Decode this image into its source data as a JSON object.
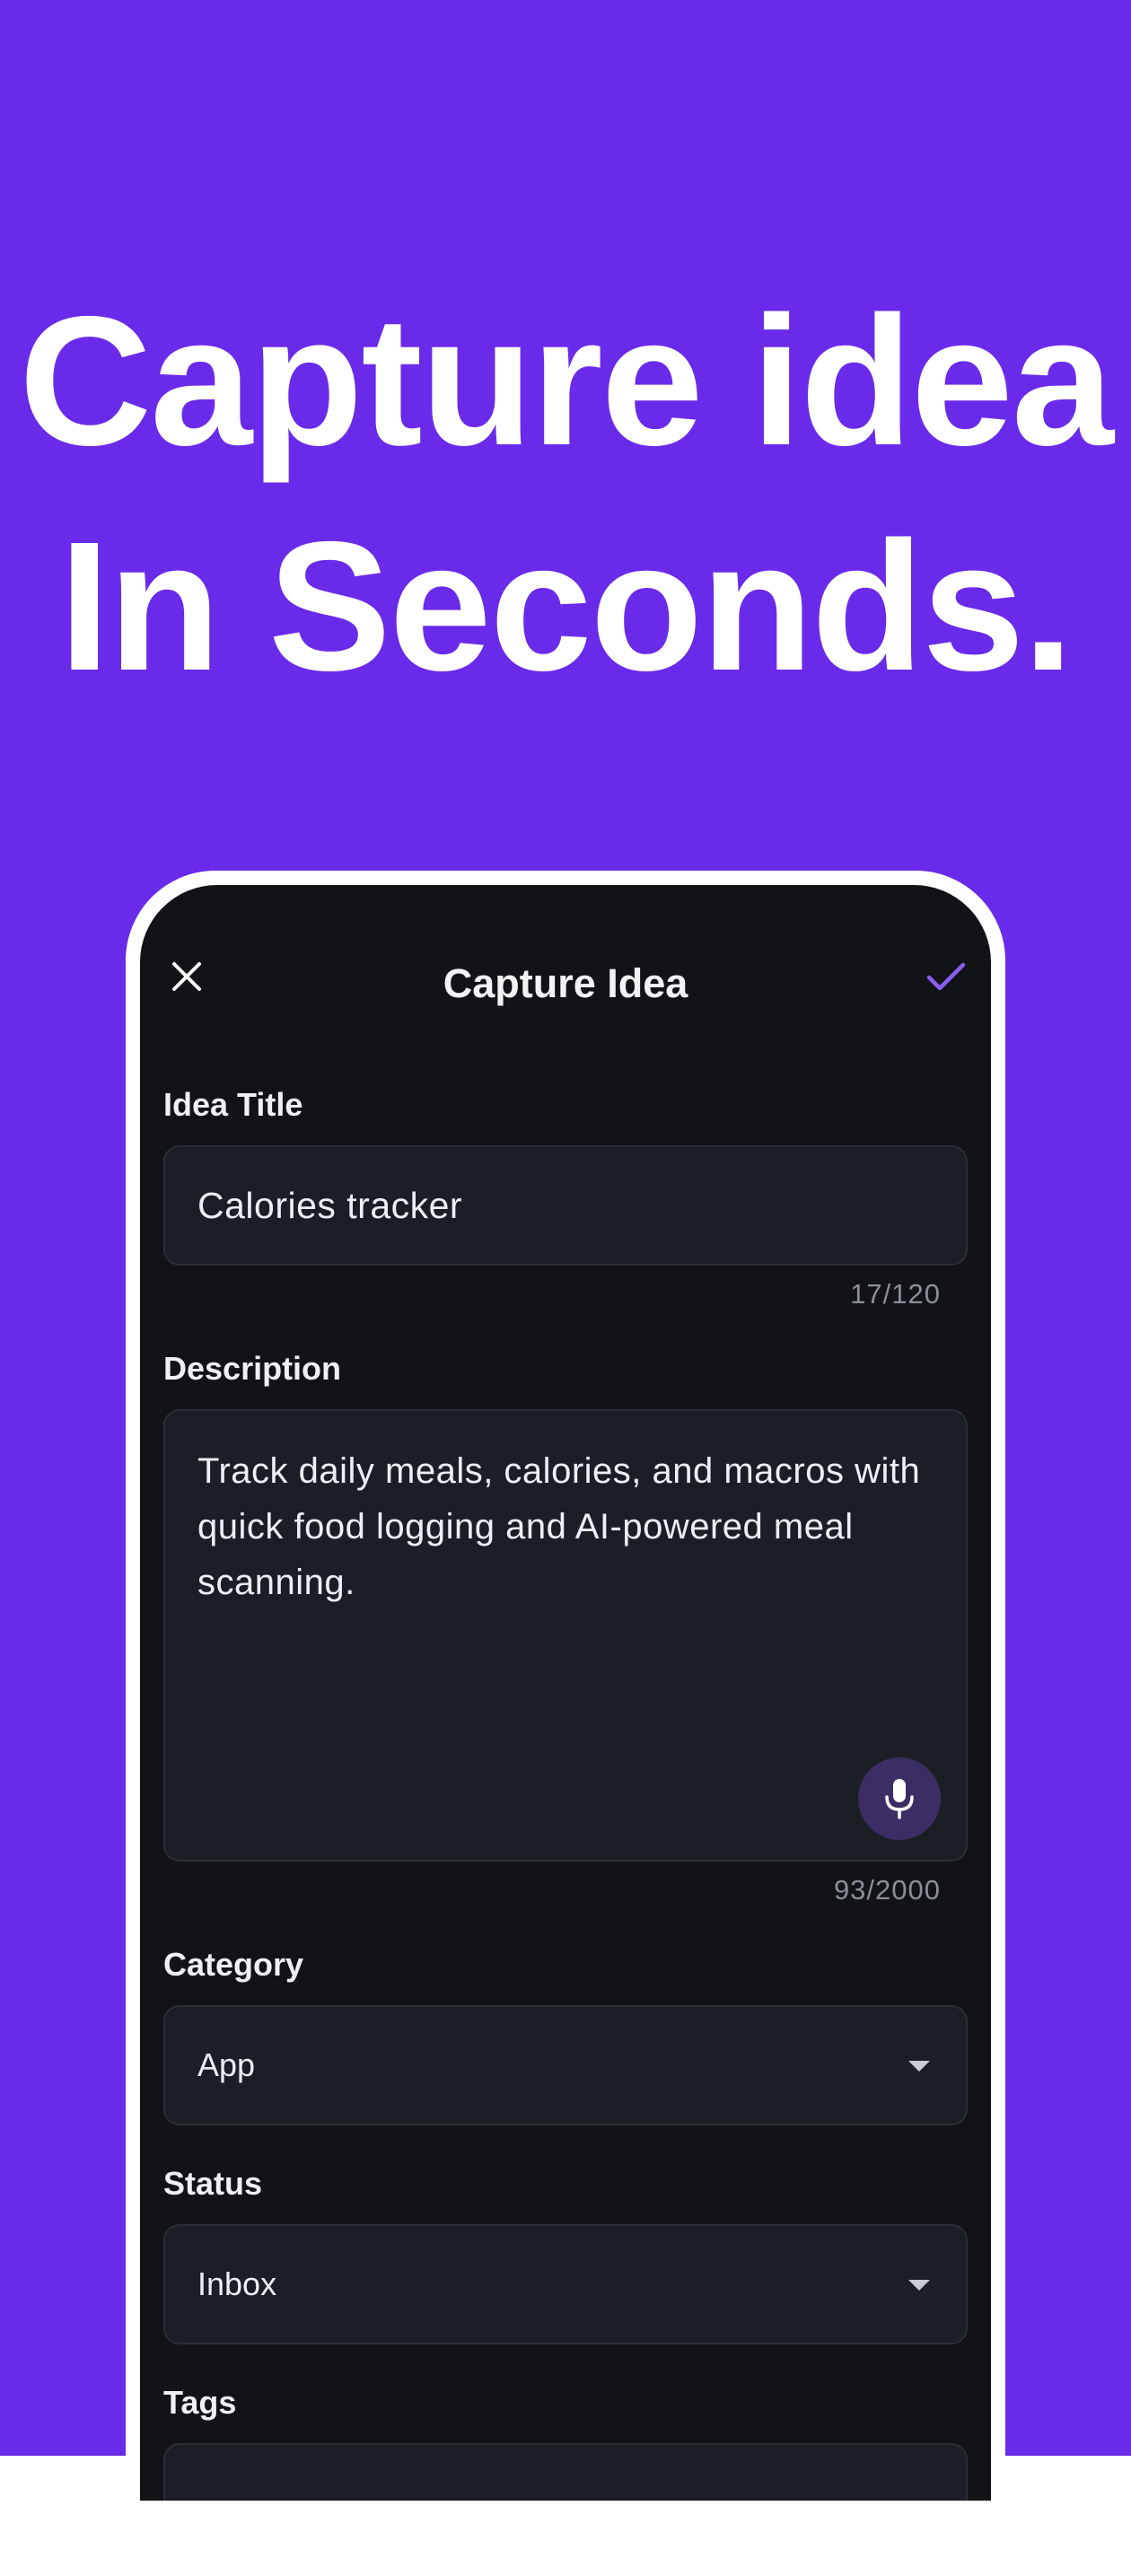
{
  "hero": {
    "line1": "Capture idea",
    "line2": "In Seconds."
  },
  "colors": {
    "background": "#6a2ae9",
    "accent": "#8b5cf6",
    "screen": "#121316",
    "field": "#1b1e25"
  },
  "topbar": {
    "title": "Capture Idea",
    "close_icon": "close-icon",
    "confirm_icon": "check-icon"
  },
  "form": {
    "idea_title": {
      "label": "Idea Title",
      "value": "Calories tracker",
      "counter": "17/120"
    },
    "description": {
      "label": "Description",
      "value": "Track daily meals, calories, and macros with quick food logging and AI-powered meal scanning.",
      "counter": "93/2000",
      "mic_icon": "microphone-icon"
    },
    "category": {
      "label": "Category",
      "value": "App",
      "icon": "caret-down-icon"
    },
    "status": {
      "label": "Status",
      "value": "Inbox",
      "icon": "caret-down-icon"
    },
    "tags": {
      "label": "Tags"
    }
  }
}
